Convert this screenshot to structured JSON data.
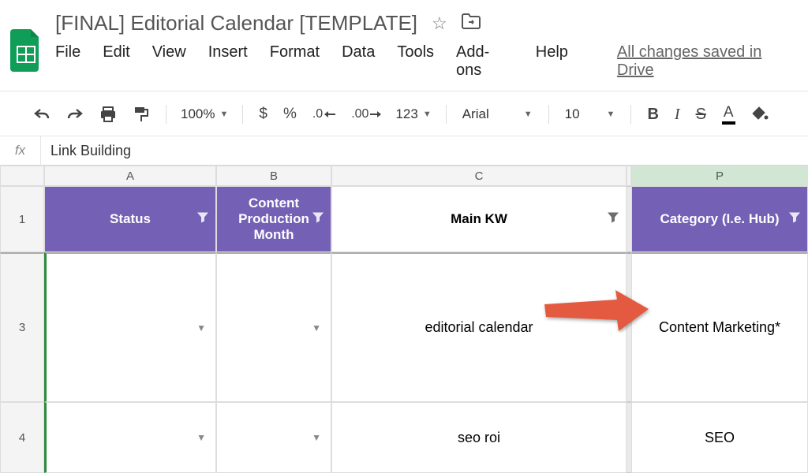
{
  "doc_title": "[FINAL] Editorial Calendar [TEMPLATE]",
  "menus": {
    "file": "File",
    "edit": "Edit",
    "view": "View",
    "insert": "Insert",
    "format": "Format",
    "data": "Data",
    "tools": "Tools",
    "addons": "Add-ons",
    "help": "Help"
  },
  "saved_text": "All changes saved in Drive",
  "toolbar": {
    "zoom": "100%",
    "currency": "$",
    "percent": "%",
    "dec_less": ".0",
    "dec_more": ".00",
    "format_more": "123",
    "font": "Arial",
    "font_size": "10",
    "bold": "B",
    "italic": "I",
    "strike": "S",
    "text_color": "A"
  },
  "fx": {
    "label": "fx",
    "value": "Link Building"
  },
  "columns": {
    "a": "A",
    "b": "B",
    "c": "C",
    "p": "P"
  },
  "headers": {
    "status": "Status",
    "production_month": "Content Production Month",
    "main_kw": "Main KW",
    "category": "Category (I.e. Hub)"
  },
  "rows": [
    {
      "num": "1"
    },
    {
      "num": "3",
      "main_kw": "editorial calendar",
      "category": "Content Marketing*"
    },
    {
      "num": "4",
      "main_kw": "seo roi",
      "category": "SEO"
    }
  ]
}
